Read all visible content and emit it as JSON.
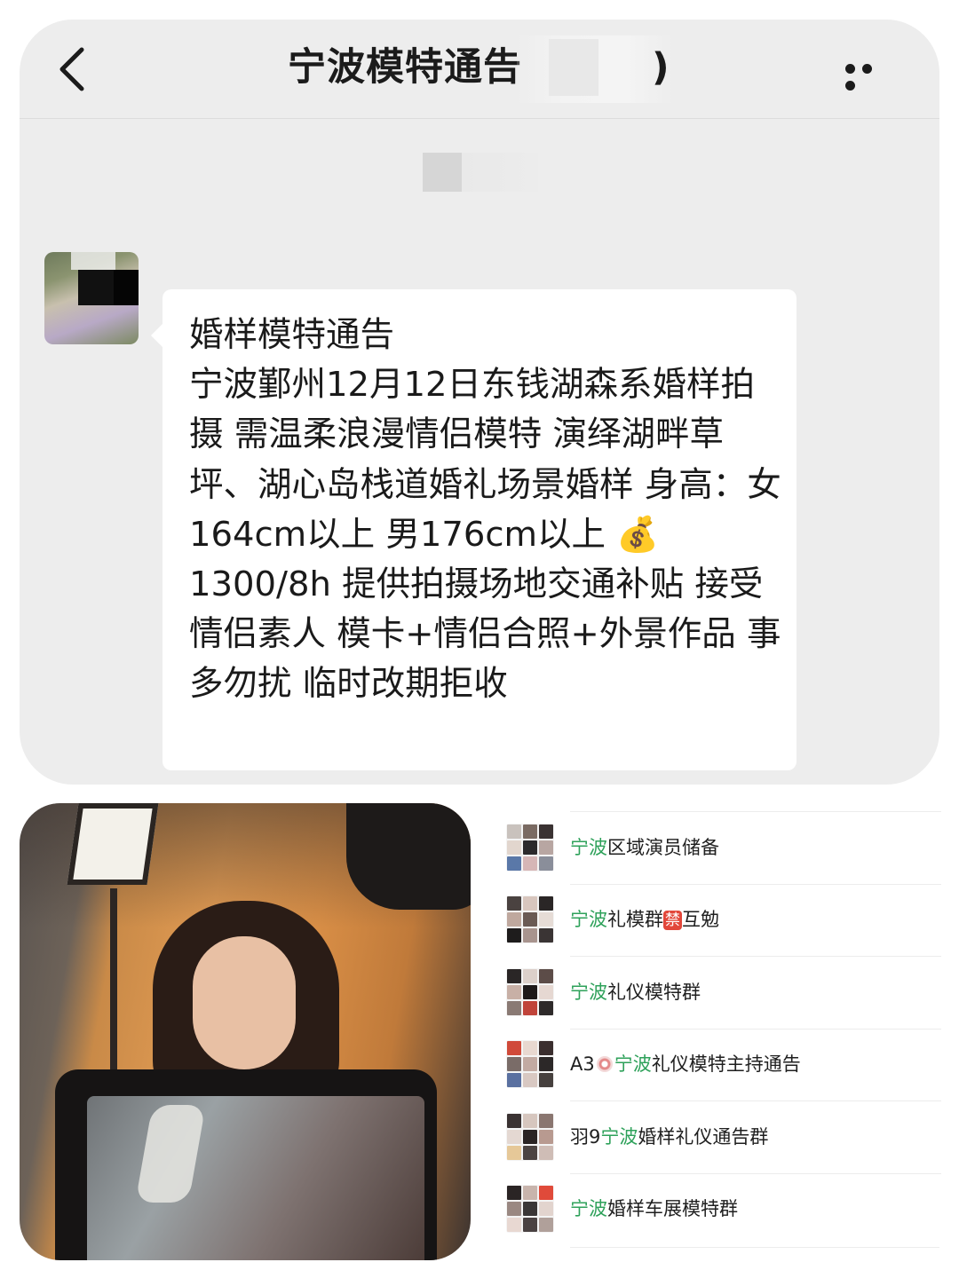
{
  "chat": {
    "header": {
      "title_visible": "宁波模特通告",
      "title_suffix": ")",
      "back_icon": "chevron-left-icon",
      "more_icon": "more-dots-icon"
    },
    "message": {
      "text": "婚样模特通告\n宁波鄞州12月12日东钱湖森系婚样拍摄 需温柔浪漫情侣模特 演绎湖畔草坪、湖心岛栈道婚礼场景婚样 身高：女164cm以上 男176cm以上 💰1300/8h 提供拍摄场地交通补贴 接受情侣素人  模卡+情侣合照+外景作品 事多勿扰 临时改期拒收"
    }
  },
  "groups": {
    "highlight_color": "#2ea15a",
    "items": [
      {
        "prefix": "",
        "highlight": "宁波",
        "rest": "区域演员储备",
        "badge": "",
        "after_badge": "",
        "colors": [
          "#c9c2bd",
          "#7a6a62",
          "#3a3232",
          "#e2d6ce",
          "#2c2a2c",
          "#b8a6a2",
          "#5a78a8",
          "#d6b6b6",
          "#8a8e9a"
        ]
      },
      {
        "prefix": "",
        "highlight": "宁波",
        "rest": "礼模群",
        "badge": "禁",
        "after_badge": "互勉",
        "colors": [
          "#4a4240",
          "#d8c6be",
          "#2a2626",
          "#bfa89e",
          "#6a5a54",
          "#e6dcd6",
          "#1e1c1c",
          "#a8948e",
          "#3a3434"
        ]
      },
      {
        "prefix": "",
        "highlight": "宁波",
        "rest": "礼仪模特群",
        "badge": "",
        "after_badge": "",
        "colors": [
          "#2a2626",
          "#dcd0ca",
          "#5c4c48",
          "#c8b0a6",
          "#1e1a1a",
          "#e6d8d2",
          "#8a7a74",
          "#c0443a",
          "#2e2a2a"
        ]
      },
      {
        "prefix": "A3",
        "emoji": true,
        "highlight": "宁波",
        "rest": "礼仪模特主持通告",
        "badge": "",
        "after_badge": "",
        "colors": [
          "#d04a3a",
          "#e8d8d0",
          "#3a2e2e",
          "#7a6c68",
          "#c2aaa2",
          "#2c2828",
          "#5a70a0",
          "#d8c8c2",
          "#46403e"
        ]
      },
      {
        "prefix": "羽9",
        "highlight": "宁波",
        "rest": "婚样礼仪通告群",
        "badge": "",
        "after_badge": "",
        "colors": [
          "#3a3232",
          "#d6c6be",
          "#8a7670",
          "#e4d8d2",
          "#2a2424",
          "#b89a90",
          "#e6c898",
          "#4c4442",
          "#cfbdb6"
        ]
      },
      {
        "prefix": "",
        "highlight": "宁波",
        "rest": "婚样车展模特群",
        "badge": "",
        "after_badge": "",
        "colors": [
          "#2a2424",
          "#c8b4ac",
          "#e04a3a",
          "#9a8882",
          "#3a3636",
          "#e2d4ce",
          "#e8d8d2",
          "#4a4242",
          "#b0a09a"
        ]
      }
    ]
  }
}
